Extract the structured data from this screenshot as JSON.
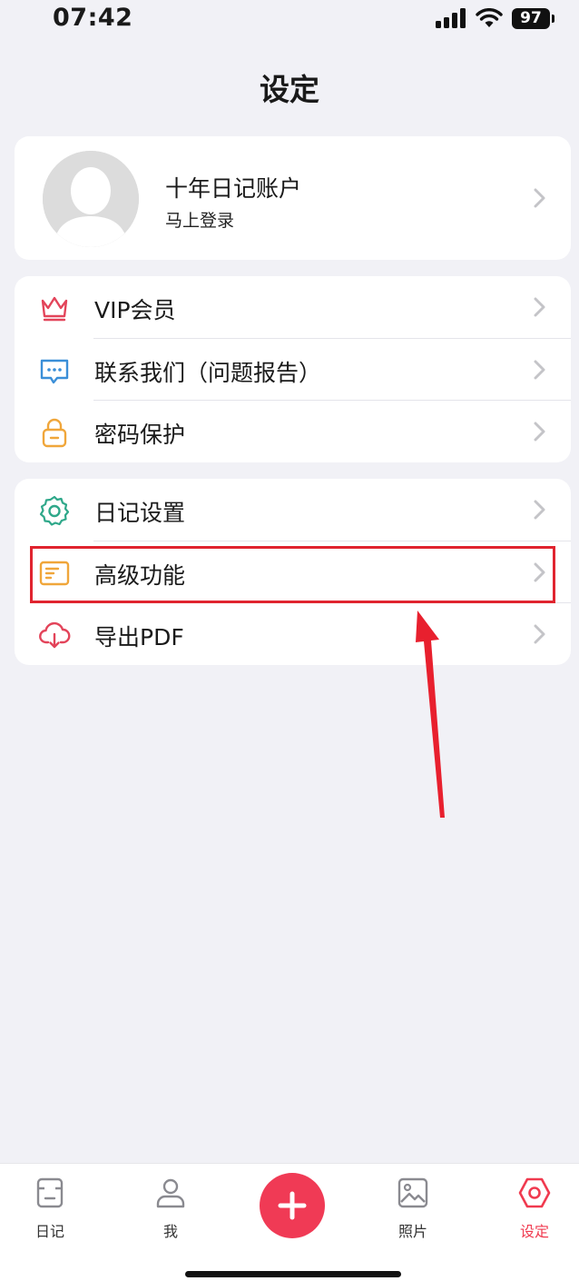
{
  "status": {
    "time": "07:42",
    "battery": "97"
  },
  "header": {
    "title": "设定"
  },
  "profile": {
    "name": "十年日记账户",
    "subtitle": "马上登录"
  },
  "group1": {
    "items": [
      {
        "label": "VIP会员",
        "icon": "crown-icon"
      },
      {
        "label": "联系我们（问题报告）",
        "icon": "message-icon"
      },
      {
        "label": "密码保护",
        "icon": "lock-icon"
      }
    ]
  },
  "group2": {
    "items": [
      {
        "label": "日记设置",
        "icon": "gear-icon"
      },
      {
        "label": "高级功能",
        "icon": "card-icon"
      },
      {
        "label": "导出PDF",
        "icon": "cloud-download-icon"
      }
    ]
  },
  "tabbar": {
    "items": [
      {
        "label": "日记",
        "icon": "diary-icon"
      },
      {
        "label": "我",
        "icon": "person-icon"
      },
      {
        "label": "照片",
        "icon": "photo-icon"
      },
      {
        "label": "设定",
        "icon": "settings-hex-icon",
        "active": true
      }
    ]
  },
  "colors": {
    "accent": "#f03a55",
    "highlight_box": "#e0242f",
    "background": "#f1f1f6"
  }
}
